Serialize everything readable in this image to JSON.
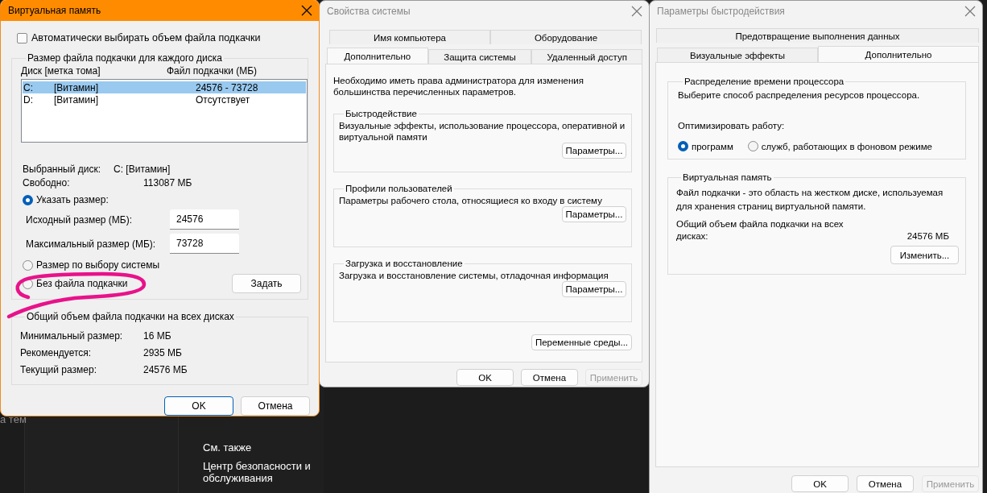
{
  "background_window": {
    "partial_text": "а тем",
    "see_also": "См. также",
    "link": "Центр безопасности и обслуживания"
  },
  "virtual_memory_dialog": {
    "title": "Виртуальная память",
    "active": true,
    "auto_checkbox": {
      "label": "Автоматически выбирать объем файла подкачки",
      "checked": false
    },
    "per_disk_group": {
      "title": "Размер файла подкачки для каждого диска",
      "columns": [
        "Диск [метка тома]",
        "Файл подкачки (МБ)"
      ],
      "rows": [
        {
          "drive": "C:",
          "label": "[Витамин]",
          "size": "24576 - 73728",
          "selected": true
        },
        {
          "drive": "D:",
          "label": "[Витамин]",
          "size": "Отсутствует",
          "selected": false
        }
      ],
      "selected_drive_label": "Выбранный диск:",
      "selected_drive_value": "C:  [Витамин]",
      "free_label": "Свободно:",
      "free_value": "113087 МБ",
      "options": [
        {
          "label": "Указать размер:",
          "selected": true
        },
        {
          "label": "Размер по выбору системы",
          "selected": false
        },
        {
          "label": "Без файла подкачки",
          "selected": false
        }
      ],
      "initial_size": {
        "label": "Исходный размер (МБ):",
        "value": "24576"
      },
      "max_size": {
        "label": "Максимальный размер (МБ):",
        "value": "73728"
      },
      "set_button": "Задать"
    },
    "total_group": {
      "title": "Общий объем файла подкачки на всех дисках",
      "rows": [
        {
          "label": "Минимальный размер:",
          "value": "16 МБ"
        },
        {
          "label": "Рекомендуется:",
          "value": "2935 МБ"
        },
        {
          "label": "Текущий размер:",
          "value": "24576 МБ"
        }
      ]
    },
    "buttons": [
      {
        "label": "OK",
        "default": true,
        "disabled": false
      },
      {
        "label": "Отмена",
        "default": false,
        "disabled": false
      }
    ]
  },
  "system_properties_dialog": {
    "title": "Свойства системы",
    "active": false,
    "tab_rows": [
      [
        {
          "label": "Имя компьютера",
          "selected": false
        },
        {
          "label": "Оборудование",
          "selected": false
        }
      ],
      [
        {
          "label": "Дополнительно",
          "selected": true
        },
        {
          "label": "Защита системы",
          "selected": false
        },
        {
          "label": "Удаленный доступ",
          "selected": false
        }
      ]
    ],
    "note": "Необходимо иметь права администратора для изменения большинства перечисленных параметров.",
    "groups": [
      {
        "title": "Быстродействие",
        "text": "Визуальные эффекты, использование процессора, оперативной и виртуальной памяти",
        "button": "Параметры..."
      },
      {
        "title": "Профили пользователей",
        "text": "Параметры рабочего стола, относящиеся ко входу в систему",
        "button": "Параметры..."
      },
      {
        "title": "Загрузка и восстановление",
        "text": "Загрузка и восстановление системы, отладочная информация",
        "button": "Параметры..."
      }
    ],
    "env_button": "Переменные среды...",
    "buttons": [
      {
        "label": "OK",
        "default": false,
        "disabled": false
      },
      {
        "label": "Отмена",
        "default": false,
        "disabled": false
      },
      {
        "label": "Применить",
        "default": false,
        "disabled": true
      }
    ]
  },
  "performance_options_dialog": {
    "title": "Параметры быстродействия",
    "active": false,
    "tab_rows": [
      [
        {
          "label": "Предотвращение выполнения данных",
          "selected": false
        }
      ],
      [
        {
          "label": "Визуальные эффекты",
          "selected": false
        },
        {
          "label": "Дополнительно",
          "selected": true
        }
      ]
    ],
    "cpu_group": {
      "title": "Распределение времени процессора",
      "text": "Выберите способ распределения ресурсов процессора.",
      "optimize_label": "Оптимизировать работу:",
      "options": [
        {
          "label": "программ",
          "selected": true
        },
        {
          "label": "служб, работающих в фоновом режиме",
          "selected": false
        }
      ]
    },
    "vm_group": {
      "title": "Виртуальная память",
      "text": "Файл подкачки - это область на жестком диске, используемая для хранения страниц виртуальной памяти.",
      "total_label": "Общий объем файла подкачки на всех дисках:",
      "total_value": "24576 МБ",
      "button": "Изменить..."
    },
    "buttons": [
      {
        "label": "OK",
        "default": false,
        "disabled": false
      },
      {
        "label": "Отмена",
        "default": false,
        "disabled": false
      },
      {
        "label": "Применить",
        "default": false,
        "disabled": true
      }
    ]
  }
}
